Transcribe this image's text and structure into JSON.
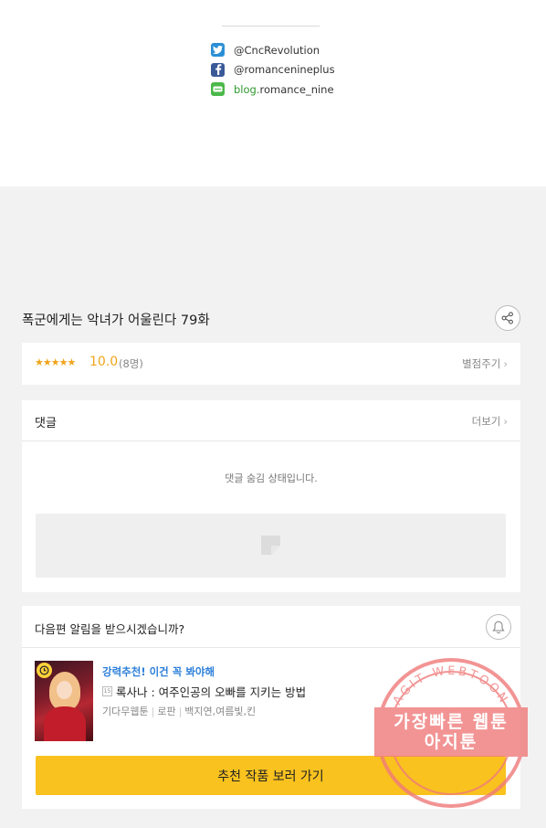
{
  "social": [
    {
      "icon": "twitter-icon",
      "text": "@CncRevolution"
    },
    {
      "icon": "facebook-icon",
      "text": "@romancenineplus"
    },
    {
      "icon": "blog-icon",
      "prefix": "blog.",
      "text": "romance_nine"
    }
  ],
  "episode": {
    "title": "폭군에게는 악녀가 어울린다 79화"
  },
  "rating": {
    "stars": "★★★★★",
    "score": "10.0",
    "count": "(8명)",
    "rate_link": "별점주기"
  },
  "comments": {
    "title": "댓글",
    "more": "더보기",
    "hidden_message": "댓글 숨김 상태입니다."
  },
  "notify": {
    "question": "다음편 알림을 받으시겠습니까?",
    "rec_tag": "강력추천! 이건 꼭 봐야해",
    "rec_title": "록사나 : 여주인공의 오빠를 지키는 방법",
    "rec_meta": [
      "기다무웹툰",
      "로판",
      "백지연,여름빛,킨"
    ],
    "cta": "추천 작품 보러 가기"
  },
  "watermark": {
    "line1": "가장빠른 웹툰",
    "line2": "아지툰",
    "ring_text": "AGIT WEBTOON"
  },
  "colors": {
    "accent_yellow": "#f9c21f",
    "star": "#f0a51b",
    "link_blue": "#2c7fd9",
    "stamp": "#f07a7a"
  }
}
